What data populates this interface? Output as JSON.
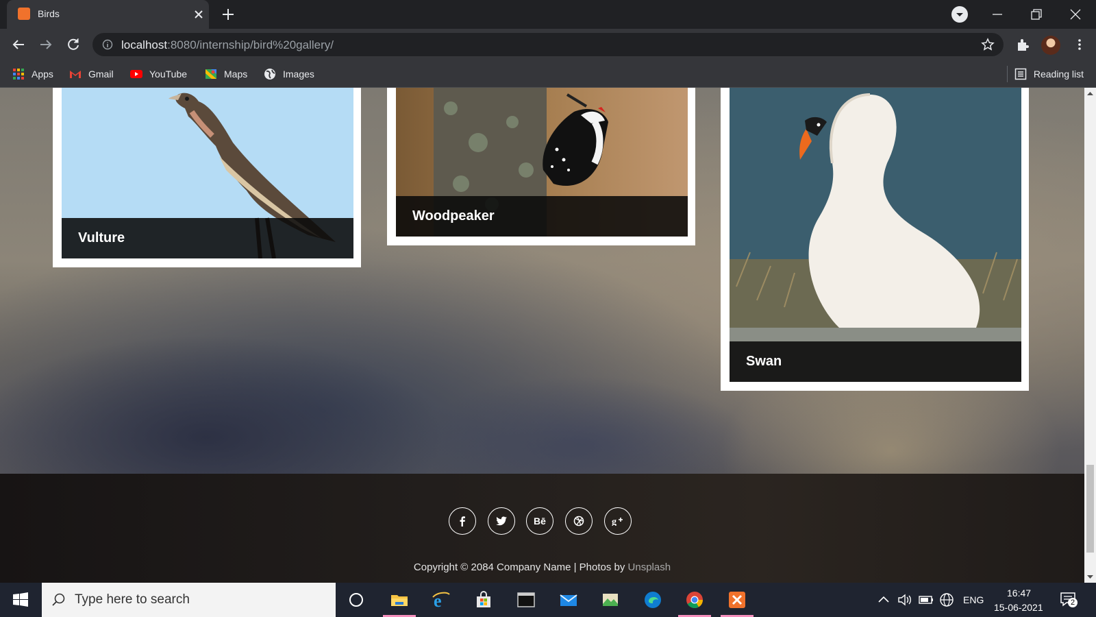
{
  "browser": {
    "tab_title": "Birds",
    "url_host": "localhost",
    "url_path": ":8080/internship/bird%20gallery/",
    "bookmarks": [
      "Apps",
      "Gmail",
      "YouTube",
      "Maps",
      "Images"
    ],
    "reading_list": "Reading list"
  },
  "gallery": {
    "cards": [
      {
        "caption": "Vulture"
      },
      {
        "caption": "Woodpeaker"
      },
      {
        "caption": "Swan"
      }
    ]
  },
  "footer": {
    "social": [
      "facebook-icon",
      "twitter-icon",
      "behance-icon",
      "dribbble-icon",
      "google-plus-icon"
    ],
    "behance_label": "Bē",
    "copyright": "Copyright © 2084 Company Name | Photos by ",
    "credit_link": "Unsplash"
  },
  "taskbar": {
    "search_placeholder": "Type here to search",
    "language": "ENG",
    "time": "16:47",
    "date": "15-06-2021",
    "notifications": "2"
  },
  "colors": {
    "tab_favicon": "#f0722c",
    "active_app_underline": "#f58fbd"
  }
}
